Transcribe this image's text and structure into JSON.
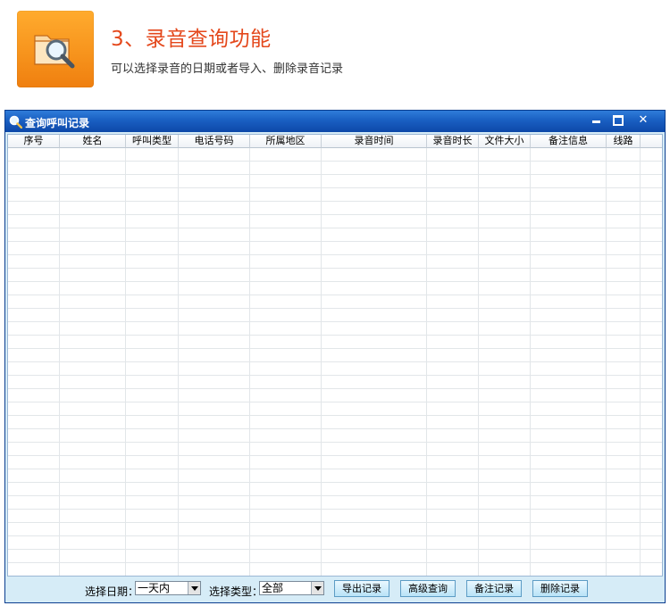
{
  "header": {
    "title": "3、录音查询功能",
    "subtitle": "可以选择录音的日期或者导入、删除录音记录",
    "icon": "folder-search-icon",
    "icon_color": "#f7941d",
    "title_color": "#e4481c"
  },
  "window": {
    "title": "查询呼叫记录",
    "title_icon": "magnifier-icon",
    "titlebar_color": "#1a5fc2",
    "controls": [
      "minimize",
      "maximize",
      "close"
    ]
  },
  "table": {
    "columns": [
      "序号",
      "姓名",
      "呼叫类型",
      "电话号码",
      "所属地区",
      "录音时间",
      "录音时长",
      "文件大小",
      "备注信息",
      "线路"
    ],
    "rows": []
  },
  "toolbar": {
    "date_label": "选择日期：",
    "date_value": "一天内",
    "type_label": "选择类型：",
    "type_value": "全部",
    "export_label": "导出记录",
    "advanced_label": "高级查询",
    "remark_label": "备注记录",
    "delete_label": "删除记录"
  }
}
